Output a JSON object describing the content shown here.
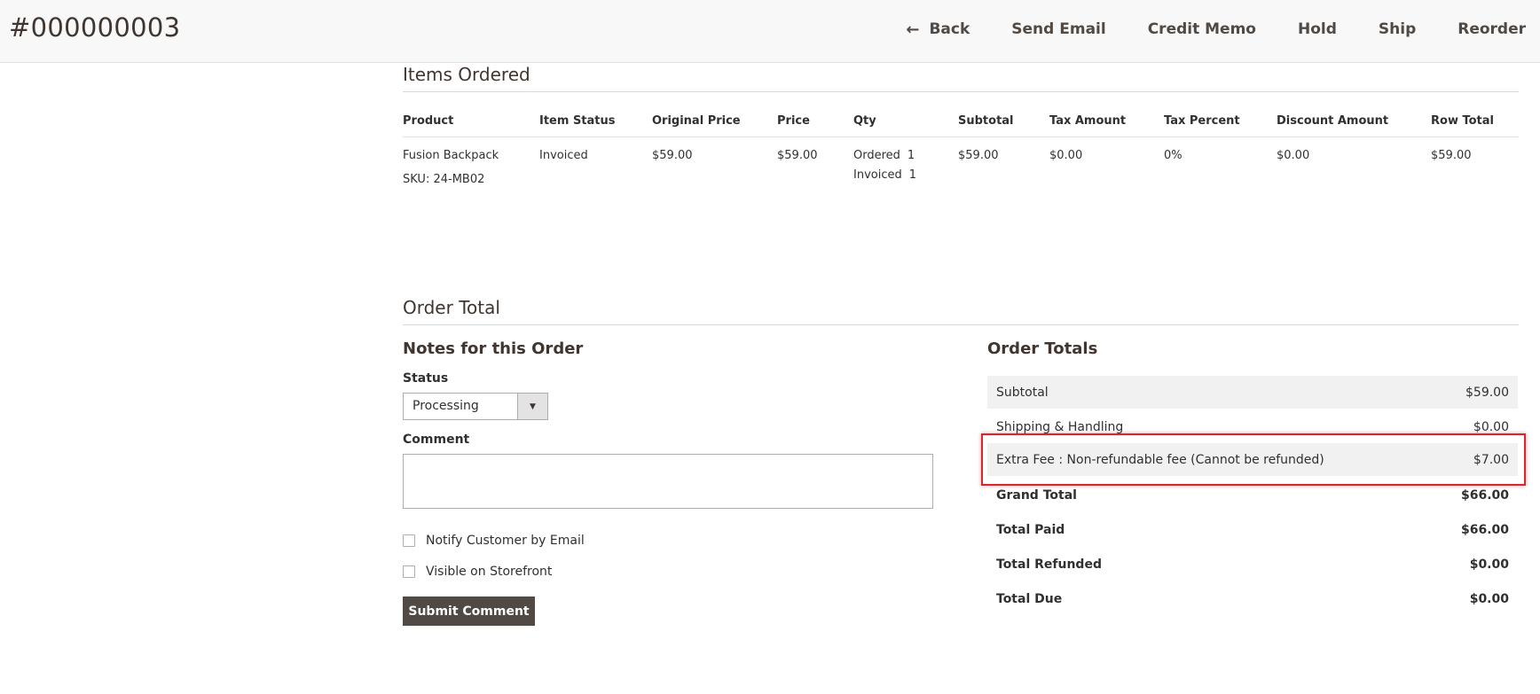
{
  "header": {
    "order_id": "#000000003",
    "actions": [
      {
        "label": "Back",
        "icon": "arrow-left-icon"
      },
      {
        "label": "Send Email"
      },
      {
        "label": "Credit Memo"
      },
      {
        "label": "Hold"
      },
      {
        "label": "Ship"
      },
      {
        "label": "Reorder"
      }
    ]
  },
  "items_section": {
    "title": "Items Ordered",
    "columns": [
      "Product",
      "Item Status",
      "Original Price",
      "Price",
      "Qty",
      "Subtotal",
      "Tax Amount",
      "Tax Percent",
      "Discount Amount",
      "Row Total"
    ],
    "rows": [
      {
        "product": "Fusion Backpack",
        "sku": "SKU: 24-MB02",
        "item_status": "Invoiced",
        "original_price": "$59.00",
        "price": "$59.00",
        "qty_ordered_label": "Ordered",
        "qty_ordered": "1",
        "qty_invoiced_label": "Invoiced",
        "qty_invoiced": "1",
        "subtotal": "$59.00",
        "tax_amount": "$0.00",
        "tax_percent": "0%",
        "discount_amount": "$0.00",
        "row_total": "$59.00"
      }
    ]
  },
  "order_total_section": {
    "title": "Order Total",
    "notes": {
      "title": "Notes for this Order",
      "status_label": "Status",
      "status_value": "Processing",
      "comment_label": "Comment",
      "comment_value": "",
      "notify_label": "Notify Customer by Email",
      "visible_label": "Visible on Storefront",
      "submit_label": "Submit Comment"
    },
    "totals": {
      "title": "Order Totals",
      "rows": [
        {
          "label": "Subtotal",
          "value": "$59.00"
        },
        {
          "label": "Shipping & Handling",
          "value": "$0.00"
        },
        {
          "label": "Extra Fee : Non-refundable fee (Cannot be refunded)",
          "value": "$7.00"
        },
        {
          "label": "Grand Total",
          "value": "$66.00"
        },
        {
          "label": "Total Paid",
          "value": "$66.00"
        },
        {
          "label": "Total Refunded",
          "value": "$0.00"
        },
        {
          "label": "Total Due",
          "value": "$0.00"
        }
      ]
    }
  },
  "colors": {
    "highlight": "#d8262e",
    "button_bg": "#514943",
    "header_bg": "#f8f8f8"
  }
}
